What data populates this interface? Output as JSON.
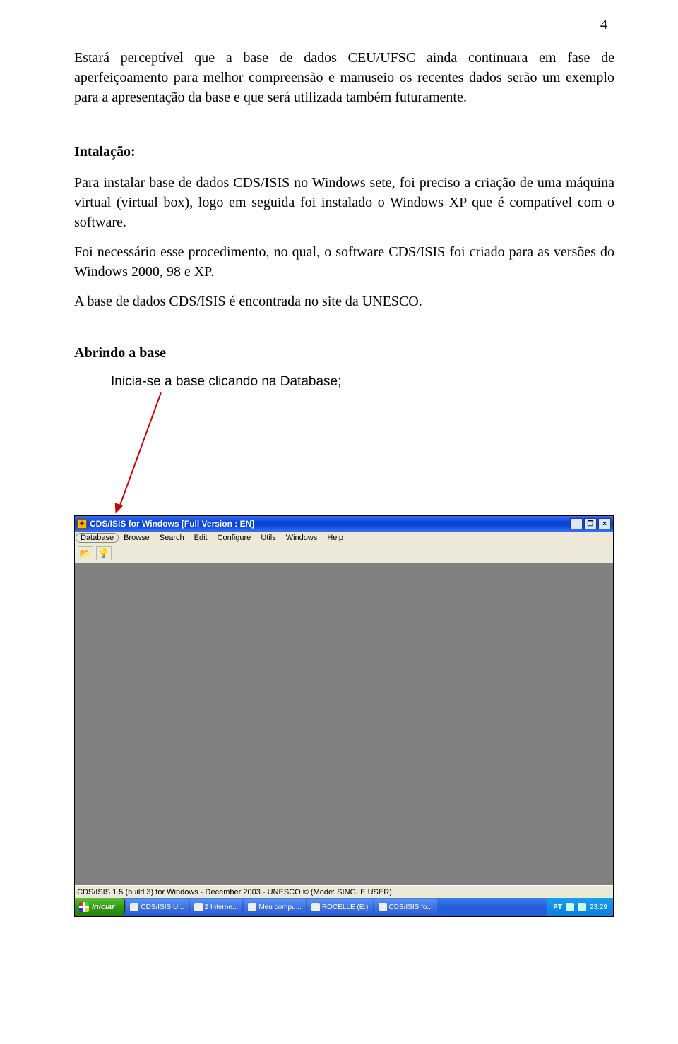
{
  "page_number": "4",
  "p1": "Estará perceptível que a base de dados CEU/UFSC ainda continuara em fase de aperfeiçoamento para melhor compreensão e manuseio os recentes dados serão um exemplo para a apresentação da base e que será utilizada também futuramente.",
  "h_install": "Intalação:",
  "p_install_1": "Para instalar base de dados CDS/ISIS no Windows sete, foi preciso a criação de uma máquina virtual (virtual box), logo em seguida foi instalado o Windows XP que é compatível com o software.",
  "p_install_2": "Foi necessário esse procedimento, no qual, o software CDS/ISIS foi criado para as versões do Windows 2000, 98 e XP.",
  "p_install_3": "A base de dados CDS/ISIS é encontrada no site da UNESCO.",
  "h_open": "Abrindo a base",
  "open_instruction": "Inicia-se a base clicando na Database;",
  "screenshot": {
    "title": "CDS/ISIS for Windows [Full Version : EN]",
    "menu": [
      "Database",
      "Browse",
      "Search",
      "Edit",
      "Configure",
      "Utils",
      "Windows",
      "Help"
    ],
    "status": "CDS/ISIS 1.5 (build 3) for Windows - December 2003 - UNESCO © (Mode: SINGLE USER)",
    "start_label": "Iniciar",
    "tasks": [
      "CDS/ISIS U...",
      "2 Interne...",
      "Meu compu...",
      "ROCELLE (E:)",
      "CDS/ISIS fo..."
    ],
    "lang": "PT",
    "clock": "23:29"
  }
}
